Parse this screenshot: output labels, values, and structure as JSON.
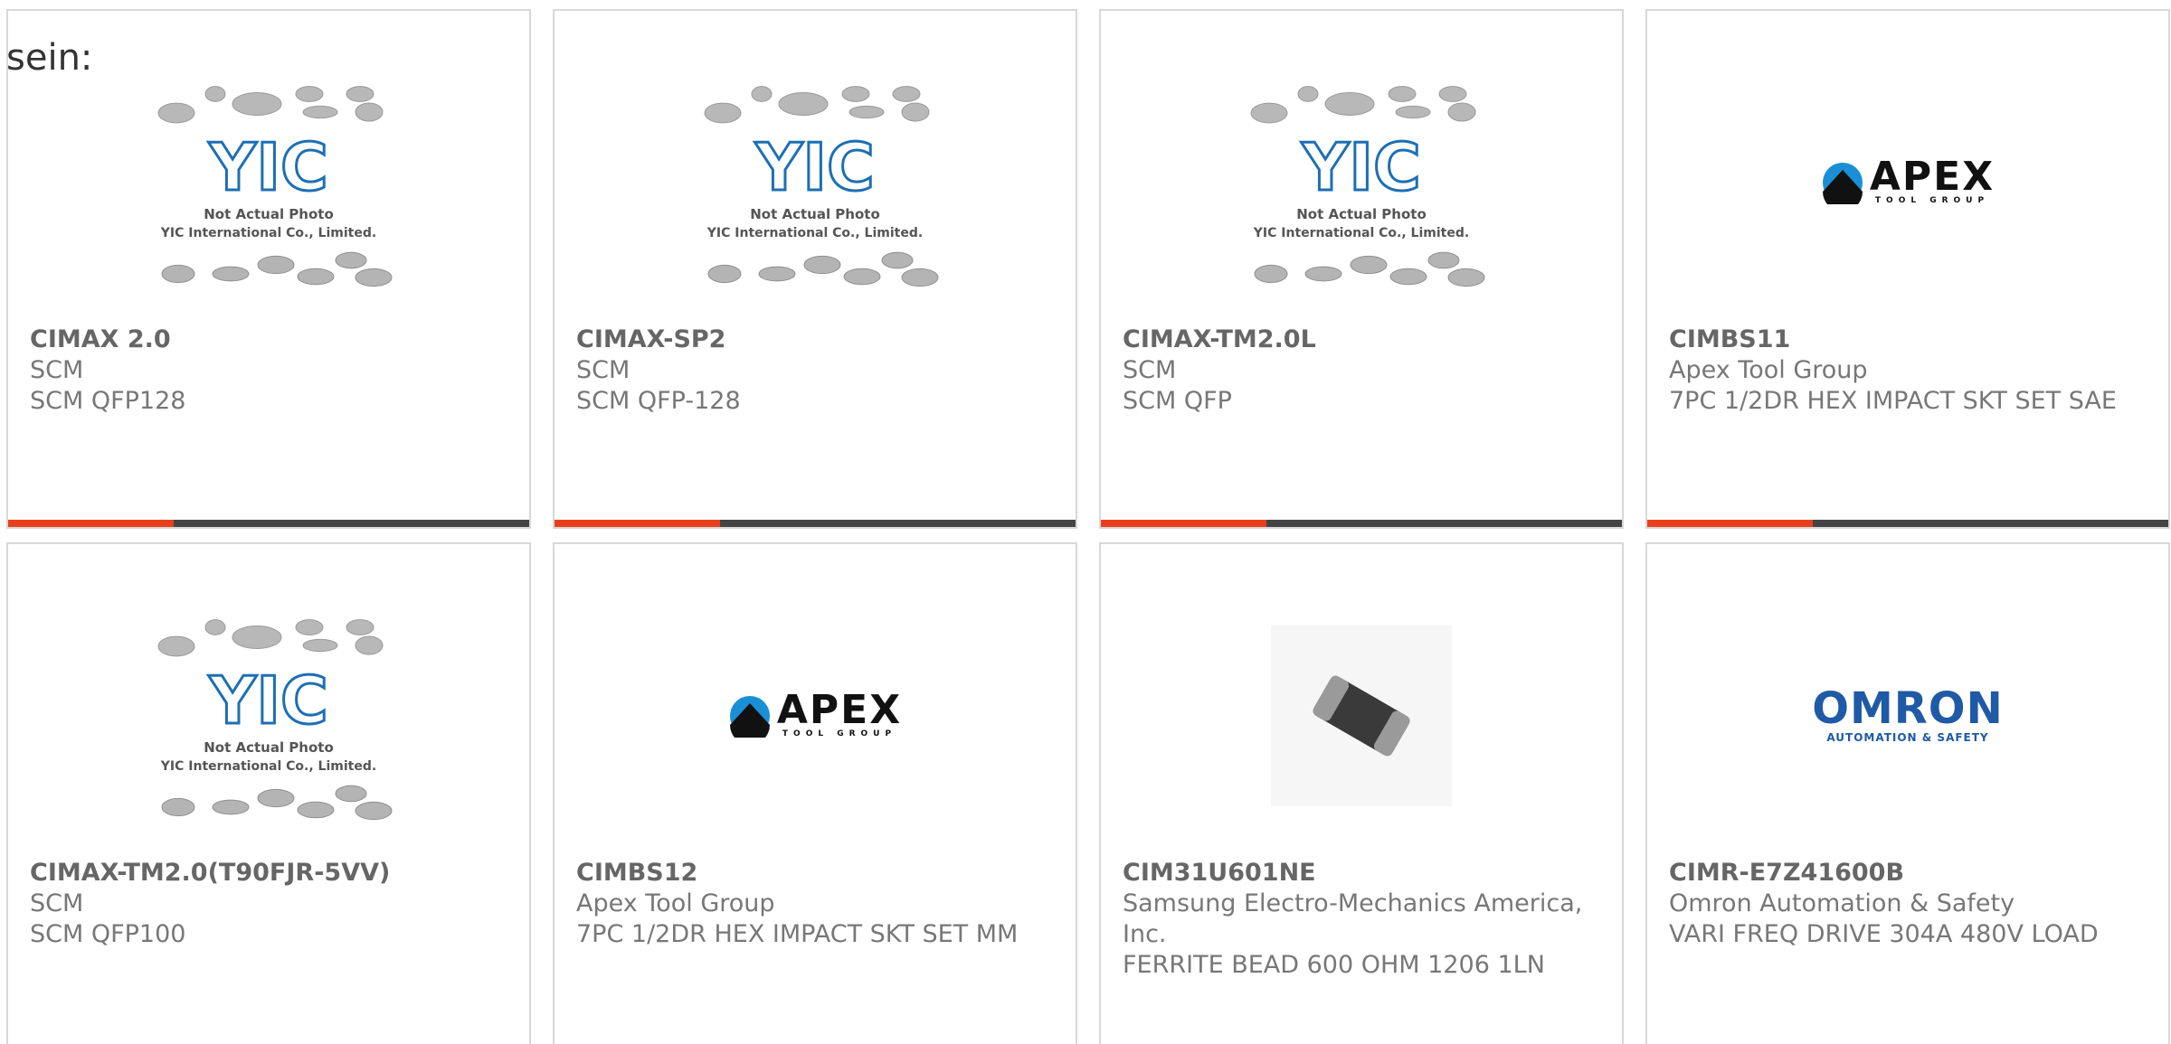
{
  "intro_text": "sein:",
  "placeholder_image": {
    "brand": "YIC",
    "line1": "Not Actual Photo",
    "line2": "YIC International Co., Limited."
  },
  "logos": {
    "apex": {
      "name": "APEX",
      "tagline": "TOOL GROUP"
    },
    "omron": {
      "name": "OMRON",
      "tagline": "AUTOMATION & SAFETY"
    }
  },
  "colors": {
    "accent": "#e8401c",
    "bar": "#444444",
    "border": "#d8d8d8",
    "yic_blue": "#1c6fb5",
    "omron_blue": "#1f5aa6"
  },
  "products": [
    {
      "image": "yic-placeholder",
      "part_number": "CIMAX 2.0",
      "manufacturer": "SCM",
      "description": "SCM QFP128"
    },
    {
      "image": "yic-placeholder",
      "part_number": "CIMAX-SP2",
      "manufacturer": "SCM",
      "description": "SCM QFP-128"
    },
    {
      "image": "yic-placeholder",
      "part_number": "CIMAX-TM2.0L",
      "manufacturer": "SCM",
      "description": "SCM QFP"
    },
    {
      "image": "apex-logo",
      "part_number": "CIMBS11",
      "manufacturer": "Apex Tool Group",
      "description": "7PC 1/2DR HEX IMPACT SKT SET SAE"
    },
    {
      "image": "yic-placeholder",
      "part_number": "CIMAX-TM2.0(T90FJR-5VV)",
      "manufacturer": "SCM",
      "description": "SCM QFP100"
    },
    {
      "image": "apex-logo",
      "part_number": "CIMBS12",
      "manufacturer": "Apex Tool Group",
      "description": "7PC 1/2DR HEX IMPACT SKT SET MM"
    },
    {
      "image": "ferrite-bead-photo",
      "part_number": "CIM31U601NE",
      "manufacturer": "Samsung Electro-Mechanics America, Inc.",
      "description": "FERRITE BEAD 600 OHM 1206 1LN"
    },
    {
      "image": "omron-logo",
      "part_number": "CIMR-E7Z41600B",
      "manufacturer": "Omron Automation & Safety",
      "description": "VARI FREQ DRIVE 304A 480V LOAD"
    }
  ]
}
